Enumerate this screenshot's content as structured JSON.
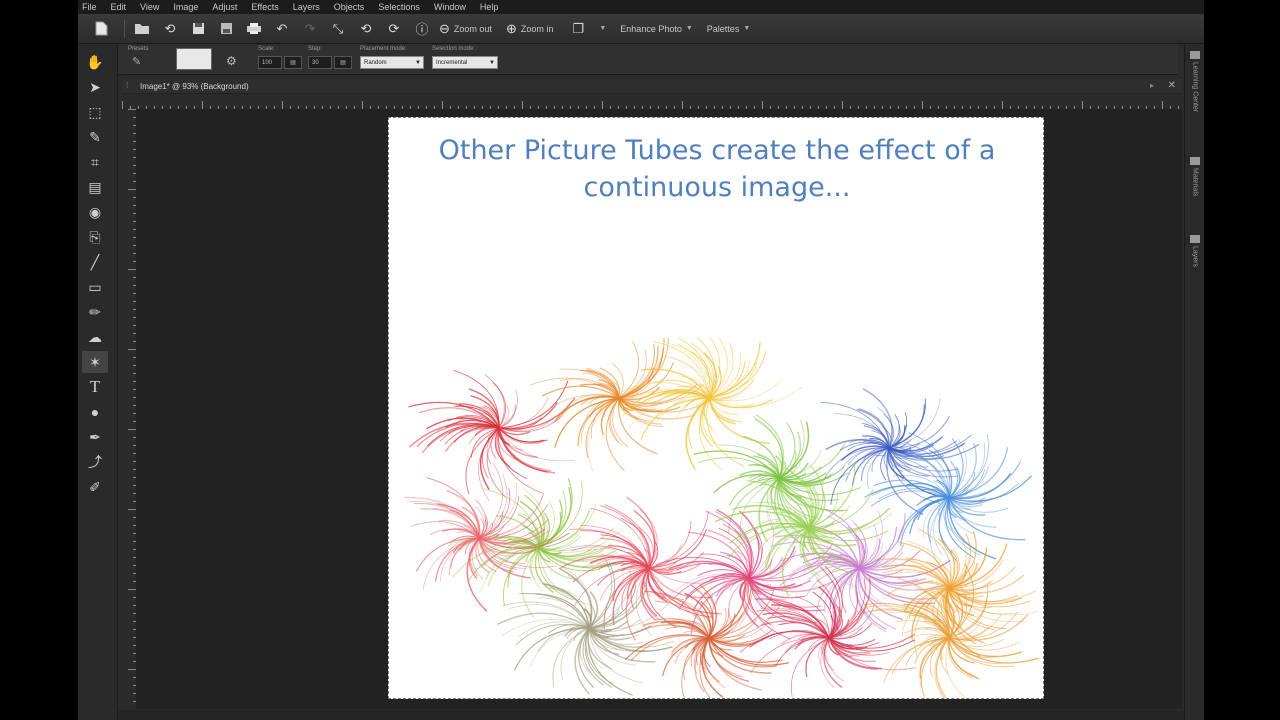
{
  "menu": [
    "File",
    "Edit",
    "View",
    "Image",
    "Adjust",
    "Effects",
    "Layers",
    "Objects",
    "Selections",
    "Window",
    "Help"
  ],
  "toolbar": {
    "zoom_out_label": "Zoom out",
    "zoom_in_label": "Zoom in",
    "enhance_photo_label": "Enhance Photo",
    "palettes_label": "Palettes"
  },
  "tool_options": {
    "presets_label": "Presets",
    "scale_label": "Scale:",
    "scale_value": "100",
    "step_label": "Step:",
    "step_value": "30",
    "placement_mode_label": "Placement mode:",
    "placement_mode_value": "Random",
    "selection_mode_label": "Selection mode:",
    "selection_mode_value": "Incremental"
  },
  "document": {
    "tab_title": "Image1* @ 93% (Background)"
  },
  "canvas": {
    "text": "Other Picture Tubes create the effect of a continuous image..."
  },
  "right_palettes": [
    "Learning Center",
    "Materials",
    "Layers"
  ],
  "colors": {
    "canvas_text": "#4f7fbf",
    "workspace": "#222222",
    "app_bg": "#2b2b2b"
  }
}
